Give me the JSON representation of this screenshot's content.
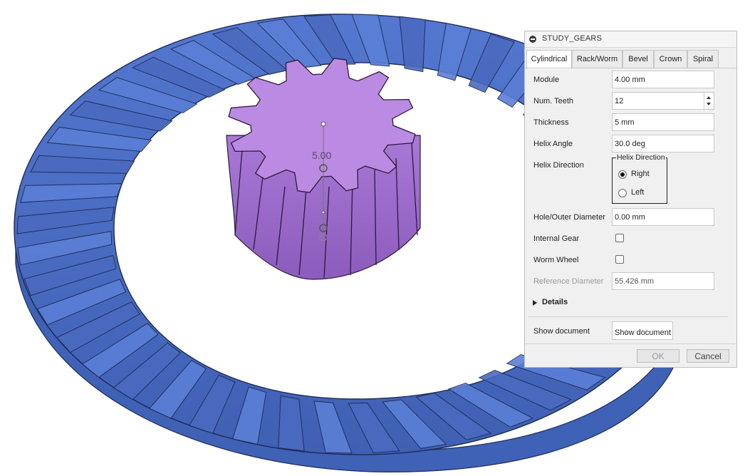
{
  "viewport": {
    "dimension_label": "5.00",
    "ring_gear_color": "#5b7fd6",
    "ring_gear_side_color": "#4a6abf",
    "pinion_color": "#bb8ae2",
    "pinion_side_color": "#9b67c5"
  },
  "dialog": {
    "title": "STUDY_GEARS",
    "tabs": [
      {
        "label": "Cylindrical",
        "active": true
      },
      {
        "label": "Rack/Worm",
        "active": false
      },
      {
        "label": "Bevel",
        "active": false
      },
      {
        "label": "Crown",
        "active": false
      },
      {
        "label": "Spiral",
        "active": false
      }
    ],
    "fields": {
      "module": {
        "label": "Module",
        "value": "4.00 mm"
      },
      "num_teeth": {
        "label": "Num. Teeth",
        "value": "12"
      },
      "thickness": {
        "label": "Thickness",
        "value": "5 mm"
      },
      "helix_angle": {
        "label": "Helix Angle",
        "value": "30.0 deg"
      },
      "helix_direction": {
        "label": "Helix Direction",
        "group_title": "Helix Direction",
        "options": [
          {
            "label": "Right",
            "selected": true
          },
          {
            "label": "Left",
            "selected": false
          }
        ]
      },
      "hole_outer_diameter": {
        "label": "Hole/Outer Diameter",
        "value": "0.00 mm"
      },
      "internal_gear": {
        "label": "Internal Gear",
        "checked": false
      },
      "worm_wheel": {
        "label": "Worm Wheel",
        "checked": false
      },
      "reference_diameter": {
        "label": "Reference Diameter",
        "value": "55.426 mm"
      }
    },
    "details_label": "Details",
    "show_document": {
      "label": "Show document",
      "button": "Show document"
    },
    "ok_label": "OK",
    "cancel_label": "Cancel"
  }
}
